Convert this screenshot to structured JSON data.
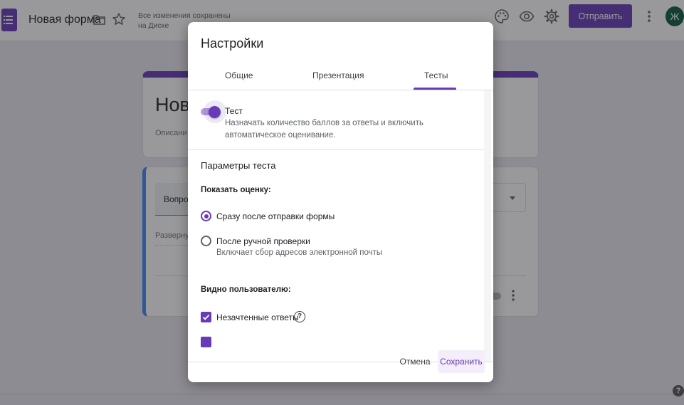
{
  "app": {
    "title": "Новая форма",
    "save_status": "Все изменения сохранены на Диске",
    "send_label": "Отправить",
    "avatar_letter": "Ж",
    "brand_color": "#673ab7",
    "icons": [
      "forms-logo-icon",
      "folder-icon",
      "star-icon",
      "palette-icon",
      "eye-icon",
      "gear-icon",
      "more-vert-icon"
    ]
  },
  "background_form": {
    "title": "Нова",
    "description": "Описани",
    "question_label": "Вопрос",
    "answer_label": "Разверну"
  },
  "dialog": {
    "title": "Настройки",
    "tabs": [
      {
        "label": "Общие",
        "active": false
      },
      {
        "label": "Презентация",
        "active": false
      },
      {
        "label": "Тесты",
        "active": true
      }
    ],
    "quiz_toggle": {
      "on": true,
      "label": "Тест",
      "description": "Назначать количество баллов за ответы и включить автоматическое оценивание."
    },
    "params_title": "Параметры теста",
    "show_grade": {
      "label": "Показать оценку:",
      "options": [
        {
          "label": "Сразу после отправки формы",
          "sub": "",
          "selected": true
        },
        {
          "label": "После ручной проверки",
          "sub": "Включает сбор адресов электронной почты",
          "selected": false
        }
      ]
    },
    "visible": {
      "label": "Видно пользователю:",
      "items": [
        {
          "label": "Незачтенные ответы",
          "checked": true,
          "help": "?"
        }
      ]
    },
    "cancel_label": "Отмена",
    "save_label": "Сохранить"
  }
}
